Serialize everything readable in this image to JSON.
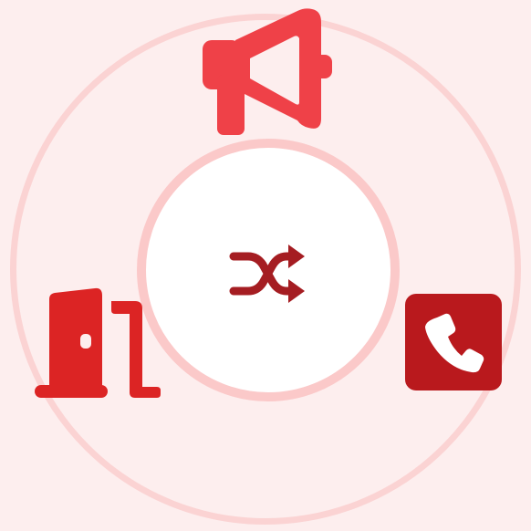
{
  "colors": {
    "background": "#fdeeee",
    "outer_ring": "#fbd3d3",
    "center_ring": "#fbc9c9",
    "center_fill": "#ffffff",
    "megaphone": "#ef4148",
    "shuffle": "#a51d22",
    "door": "#dc2424",
    "phone": "#b9191d"
  },
  "icons": {
    "top": "megaphone-icon",
    "center": "shuffle-icon",
    "left": "door-icon",
    "right": "phone-icon"
  }
}
